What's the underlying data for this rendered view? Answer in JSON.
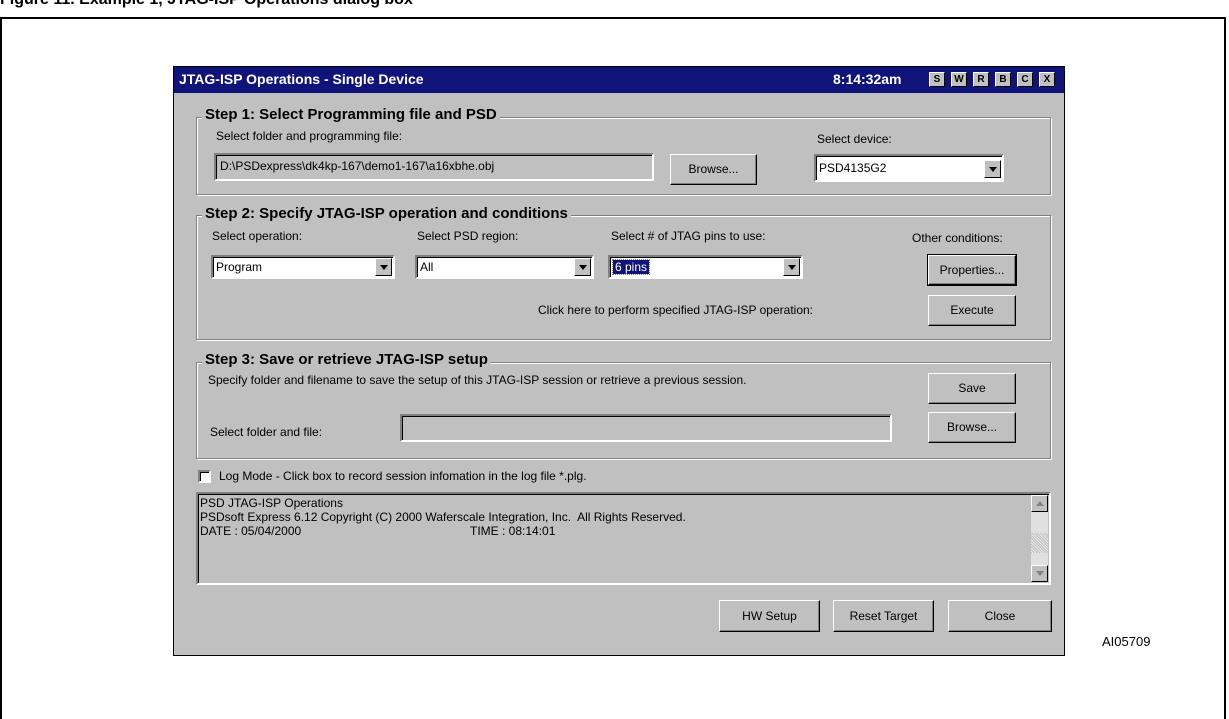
{
  "page": {
    "heading": "Figure 11. Example 1, JTAG-ISP Operations dialog box",
    "figure_code": "AI05709"
  },
  "window": {
    "title": "JTAG-ISP Operations - Single Device",
    "time": "8:14:32am",
    "title_buttons": [
      "S",
      "W",
      "R",
      "B",
      "C",
      "X"
    ]
  },
  "step1": {
    "legend": "Step 1: Select Programming file and PSD",
    "folder_label": "Select folder and programming file:",
    "file_path": "D:\\PSDexpress\\dk4kp-167\\demo1-167\\a16xbhe.obj",
    "browse_label": "Browse...",
    "device_label": "Select device:",
    "device_value": "PSD4135G2"
  },
  "step2": {
    "legend": "Step 2: Specify JTAG-ISP operation and conditions",
    "operation_label": "Select operation:",
    "operation_value": "Program",
    "region_label": "Select PSD region:",
    "region_value": "All",
    "pins_label": "Select # of JTAG pins to use:",
    "pins_value": "6 pins",
    "other_label": "Other conditions:",
    "properties_label": "Properties...",
    "execute_hint": "Click here to perform specified JTAG-ISP operation:",
    "execute_label": "Execute"
  },
  "step3": {
    "legend": "Step 3: Save or retrieve JTAG-ISP setup",
    "description": "Specify folder and filename to save the setup of this JTAG-ISP session or retrieve a previous session.",
    "save_label": "Save",
    "file_label": "Select folder and file:",
    "file_value": "",
    "browse_label": "Browse..."
  },
  "log_mode": {
    "label": "Log Mode - Click box to record session infomation in the log file *.plg.",
    "checked": false
  },
  "log": {
    "line1": "PSD JTAG-ISP Operations",
    "line2": "PSDsoft Express 6.12 Copyright (C) 2000 Waferscale Integration, Inc.  All Rights Reserved.",
    "date": "DATE : 05/04/2000",
    "time": "TIME : 08:14:01"
  },
  "footer": {
    "hw_setup": "HW Setup",
    "reset_target": "Reset Target",
    "close": "Close"
  }
}
